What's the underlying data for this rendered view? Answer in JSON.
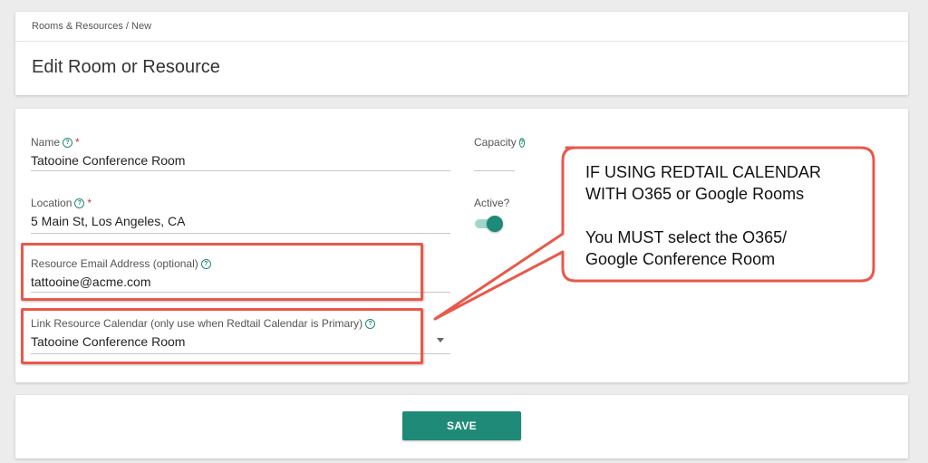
{
  "breadcrumb": "Rooms & Resources / New",
  "page_title": "Edit Room or Resource",
  "form": {
    "name": {
      "label": "Name",
      "value": "Tatooine Conference Room",
      "required": "*"
    },
    "location": {
      "label": "Location",
      "value": "5 Main St, Los Angeles, CA",
      "required": "*"
    },
    "resource_email": {
      "label": "Resource Email Address (optional)",
      "value": "tattooine@acme.com"
    },
    "link_calendar": {
      "label": "Link Resource Calendar (only use when Redtail Calendar is Primary)",
      "value": "Tatooine Conference Room"
    },
    "capacity": {
      "label": "Capacity",
      "value": ""
    },
    "active": {
      "label": "Active?",
      "state": "on"
    }
  },
  "help_glyph": "?",
  "actions": {
    "save_label": "SAVE"
  },
  "callout": {
    "line1": "IF USING REDTAIL CALENDAR",
    "line2": "WITH O365 or Google Rooms",
    "line3": "You MUST select the O365/",
    "line4": "Google Conference Room"
  },
  "colors": {
    "accent": "#1f8a77",
    "annotation": "#e8594b",
    "required": "#d32f2f"
  }
}
